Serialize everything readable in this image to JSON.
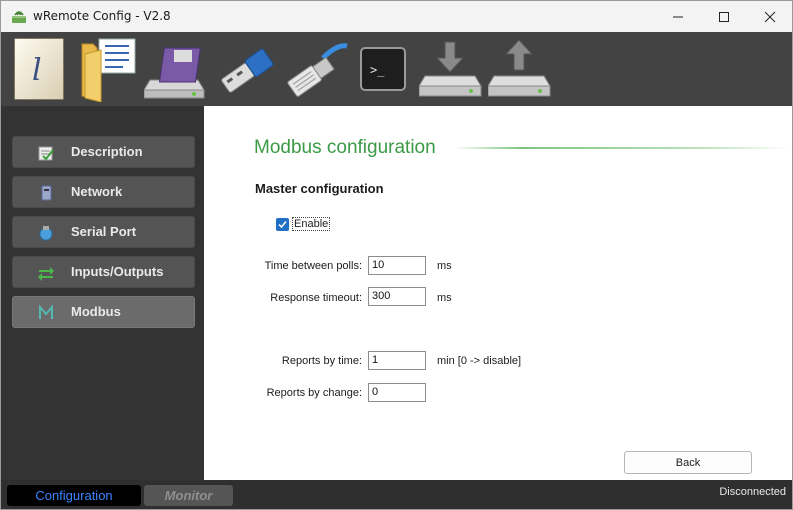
{
  "window": {
    "title": "wRemote Config - V2.8"
  },
  "toolbar": {
    "tools": [
      {
        "icon": "description-document-icon"
      },
      {
        "icon": "open-folder-icon"
      },
      {
        "icon": "save-to-disk-icon"
      },
      {
        "icon": "usb-connection-icon"
      },
      {
        "icon": "ethernet-connection-icon"
      },
      {
        "icon": "terminal-icon"
      },
      {
        "icon": "download-from-device-icon"
      },
      {
        "icon": "upload-to-device-icon"
      }
    ]
  },
  "sidebar": {
    "items": [
      {
        "label": "Description",
        "icon": "description-icon"
      },
      {
        "label": "Network",
        "icon": "network-icon"
      },
      {
        "label": "Serial Port",
        "icon": "serial-port-icon"
      },
      {
        "label": "Inputs/Outputs",
        "icon": "inputs-outputs-icon"
      },
      {
        "label": "Modbus",
        "icon": "modbus-icon",
        "active": true
      }
    ]
  },
  "main": {
    "title": "Modbus configuration",
    "section_title": "Master configuration",
    "enable": {
      "label": "Enable",
      "checked": true
    },
    "fields": {
      "time_between_polls": {
        "label": "Time between polls:",
        "value": "10",
        "unit": "ms"
      },
      "response_timeout": {
        "label": "Response timeout:",
        "value": "300",
        "unit": "ms"
      },
      "reports_by_time": {
        "label": "Reports by time:",
        "value": "1",
        "unit": "min [0 -> disable]"
      },
      "reports_by_change": {
        "label": "Reports by change:",
        "value": "0"
      }
    },
    "back_label": "Back"
  },
  "statusbar": {
    "tab_configuration": "Configuration",
    "tab_monitor": "Monitor",
    "status": "Disconnected"
  },
  "colors": {
    "accent_title": "#3c9a46",
    "toolbar_bg": "#434343",
    "sidebar_bg": "#333333",
    "checkbox": "#1f6fc5",
    "config_tab_text": "#3a86ff"
  }
}
